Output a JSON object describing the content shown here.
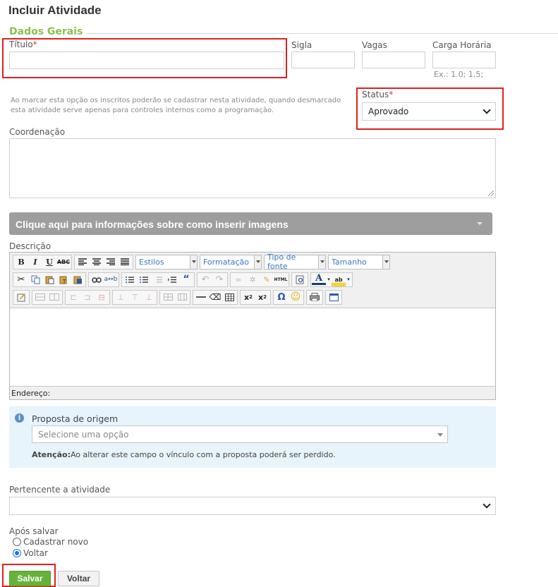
{
  "page": {
    "title": "Incluir Atividade"
  },
  "section": {
    "title": "Dados Gerais"
  },
  "fields": {
    "titulo": {
      "label": "Título",
      "required_mark": "*",
      "value": ""
    },
    "sigla": {
      "label": "Sigla",
      "value": ""
    },
    "vagas": {
      "label": "Vagas",
      "value": ""
    },
    "carga_horaria": {
      "label": "Carga Horária",
      "value": "",
      "hint": "Ex.: 1.0; 1.5;"
    },
    "note": "Ao marcar esta opção os inscritos poderão se cadastrar nesta atividade, quando desmarcado esta atividade serve apenas para controles internos como a programação.",
    "status": {
      "label": "Status",
      "required_mark": "*",
      "value": "Aprovado"
    },
    "coordenacao": {
      "label": "Coordenação",
      "value": ""
    }
  },
  "images_banner": {
    "text": "Clique aqui para informações sobre como inserir imagens"
  },
  "descricao": {
    "label": "Descrição",
    "combos": {
      "estilos": "Estilos",
      "formatacao": "Formatação",
      "tipo_fonte": "Tipo de fonte",
      "tamanho": "Tamanho"
    },
    "status_bar": "Endereço:"
  },
  "proposta": {
    "label": "Proposta de origem",
    "placeholder": "Selecione uma opção",
    "warning_bold": "Atenção:",
    "warning_text": "Ao alterar este campo o vínculo com a proposta poderá ser perdido."
  },
  "pertencente": {
    "label": "Pertencente a atividade",
    "value": ""
  },
  "apos_salvar": {
    "label": "Após salvar",
    "options": [
      {
        "label": "Cadastrar novo",
        "checked": false
      },
      {
        "label": "Voltar",
        "checked": true
      }
    ]
  },
  "buttons": {
    "save": "Salvar",
    "back": "Voltar"
  },
  "colors": {
    "section_title": "#8cc04d",
    "required": "#d9383a",
    "highlight_box": "#e02020",
    "save_button": "#67b33a",
    "info_panel": "#e7f4fb"
  }
}
